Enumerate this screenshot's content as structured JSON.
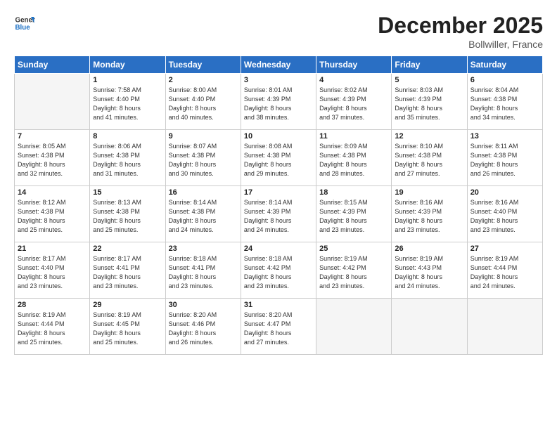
{
  "header": {
    "logo_line1": "General",
    "logo_line2": "Blue",
    "main_title": "December 2025",
    "subtitle": "Bollwiller, France"
  },
  "weekdays": [
    "Sunday",
    "Monday",
    "Tuesday",
    "Wednesday",
    "Thursday",
    "Friday",
    "Saturday"
  ],
  "weeks": [
    [
      {
        "day": "",
        "info": ""
      },
      {
        "day": "1",
        "info": "Sunrise: 7:58 AM\nSunset: 4:40 PM\nDaylight: 8 hours\nand 41 minutes."
      },
      {
        "day": "2",
        "info": "Sunrise: 8:00 AM\nSunset: 4:40 PM\nDaylight: 8 hours\nand 40 minutes."
      },
      {
        "day": "3",
        "info": "Sunrise: 8:01 AM\nSunset: 4:39 PM\nDaylight: 8 hours\nand 38 minutes."
      },
      {
        "day": "4",
        "info": "Sunrise: 8:02 AM\nSunset: 4:39 PM\nDaylight: 8 hours\nand 37 minutes."
      },
      {
        "day": "5",
        "info": "Sunrise: 8:03 AM\nSunset: 4:39 PM\nDaylight: 8 hours\nand 35 minutes."
      },
      {
        "day": "6",
        "info": "Sunrise: 8:04 AM\nSunset: 4:38 PM\nDaylight: 8 hours\nand 34 minutes."
      }
    ],
    [
      {
        "day": "7",
        "info": "Sunrise: 8:05 AM\nSunset: 4:38 PM\nDaylight: 8 hours\nand 32 minutes."
      },
      {
        "day": "8",
        "info": "Sunrise: 8:06 AM\nSunset: 4:38 PM\nDaylight: 8 hours\nand 31 minutes."
      },
      {
        "day": "9",
        "info": "Sunrise: 8:07 AM\nSunset: 4:38 PM\nDaylight: 8 hours\nand 30 minutes."
      },
      {
        "day": "10",
        "info": "Sunrise: 8:08 AM\nSunset: 4:38 PM\nDaylight: 8 hours\nand 29 minutes."
      },
      {
        "day": "11",
        "info": "Sunrise: 8:09 AM\nSunset: 4:38 PM\nDaylight: 8 hours\nand 28 minutes."
      },
      {
        "day": "12",
        "info": "Sunrise: 8:10 AM\nSunset: 4:38 PM\nDaylight: 8 hours\nand 27 minutes."
      },
      {
        "day": "13",
        "info": "Sunrise: 8:11 AM\nSunset: 4:38 PM\nDaylight: 8 hours\nand 26 minutes."
      }
    ],
    [
      {
        "day": "14",
        "info": "Sunrise: 8:12 AM\nSunset: 4:38 PM\nDaylight: 8 hours\nand 25 minutes."
      },
      {
        "day": "15",
        "info": "Sunrise: 8:13 AM\nSunset: 4:38 PM\nDaylight: 8 hours\nand 25 minutes."
      },
      {
        "day": "16",
        "info": "Sunrise: 8:14 AM\nSunset: 4:38 PM\nDaylight: 8 hours\nand 24 minutes."
      },
      {
        "day": "17",
        "info": "Sunrise: 8:14 AM\nSunset: 4:39 PM\nDaylight: 8 hours\nand 24 minutes."
      },
      {
        "day": "18",
        "info": "Sunrise: 8:15 AM\nSunset: 4:39 PM\nDaylight: 8 hours\nand 23 minutes."
      },
      {
        "day": "19",
        "info": "Sunrise: 8:16 AM\nSunset: 4:39 PM\nDaylight: 8 hours\nand 23 minutes."
      },
      {
        "day": "20",
        "info": "Sunrise: 8:16 AM\nSunset: 4:40 PM\nDaylight: 8 hours\nand 23 minutes."
      }
    ],
    [
      {
        "day": "21",
        "info": "Sunrise: 8:17 AM\nSunset: 4:40 PM\nDaylight: 8 hours\nand 23 minutes."
      },
      {
        "day": "22",
        "info": "Sunrise: 8:17 AM\nSunset: 4:41 PM\nDaylight: 8 hours\nand 23 minutes."
      },
      {
        "day": "23",
        "info": "Sunrise: 8:18 AM\nSunset: 4:41 PM\nDaylight: 8 hours\nand 23 minutes."
      },
      {
        "day": "24",
        "info": "Sunrise: 8:18 AM\nSunset: 4:42 PM\nDaylight: 8 hours\nand 23 minutes."
      },
      {
        "day": "25",
        "info": "Sunrise: 8:19 AM\nSunset: 4:42 PM\nDaylight: 8 hours\nand 23 minutes."
      },
      {
        "day": "26",
        "info": "Sunrise: 8:19 AM\nSunset: 4:43 PM\nDaylight: 8 hours\nand 24 minutes."
      },
      {
        "day": "27",
        "info": "Sunrise: 8:19 AM\nSunset: 4:44 PM\nDaylight: 8 hours\nand 24 minutes."
      }
    ],
    [
      {
        "day": "28",
        "info": "Sunrise: 8:19 AM\nSunset: 4:44 PM\nDaylight: 8 hours\nand 25 minutes."
      },
      {
        "day": "29",
        "info": "Sunrise: 8:19 AM\nSunset: 4:45 PM\nDaylight: 8 hours\nand 25 minutes."
      },
      {
        "day": "30",
        "info": "Sunrise: 8:20 AM\nSunset: 4:46 PM\nDaylight: 8 hours\nand 26 minutes."
      },
      {
        "day": "31",
        "info": "Sunrise: 8:20 AM\nSunset: 4:47 PM\nDaylight: 8 hours\nand 27 minutes."
      },
      {
        "day": "",
        "info": ""
      },
      {
        "day": "",
        "info": ""
      },
      {
        "day": "",
        "info": ""
      }
    ]
  ]
}
